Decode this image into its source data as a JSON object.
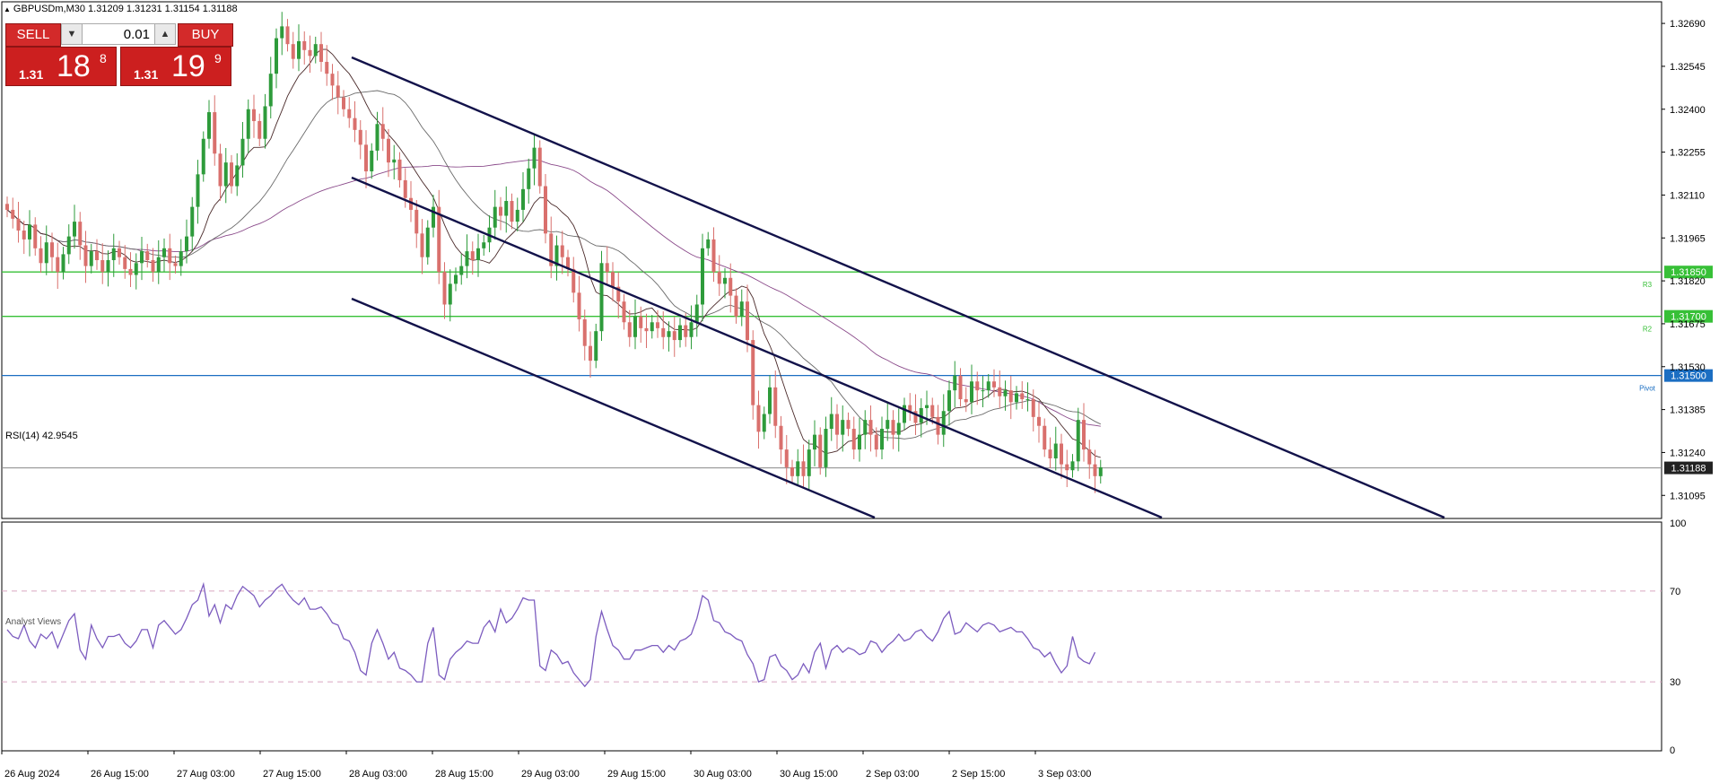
{
  "header": {
    "title": "GBPUSDm,M30  1.31209 1.31231 1.31154 1.31188"
  },
  "trade_panel": {
    "sell_label": "SELL",
    "buy_label": "BUY",
    "lot_value": "0.01",
    "sell_price": {
      "prefix": "1.31",
      "big": "18",
      "sup": "8"
    },
    "buy_price": {
      "prefix": "1.31",
      "big": "19",
      "sup": "9"
    }
  },
  "rsi_label": "RSI(14) 42.9545",
  "analyst_text": "Analyst Views",
  "colors": {
    "bull": "#2e9b3b",
    "bear": "#d9706d",
    "level_green": "#37c037",
    "pivot": "#1b6ec2",
    "channel": "#12124a",
    "ma_fast": "#4a2a2a",
    "ma_mid": "#6a6a6a",
    "ma_slow": "#8a4a8a",
    "rsi": "#7c5cbf",
    "rsi_level": "#d9a6c2",
    "current": "#888888"
  },
  "chart_data": {
    "type": "candlestick",
    "symbol": "GBPUSDm",
    "timeframe": "M30",
    "ylim": [
      1.3102,
      1.3276
    ],
    "y_ticks": [
      "1.32690",
      "1.32545",
      "1.32400",
      "1.32255",
      "1.32110",
      "1.31965",
      "1.31820",
      "1.31675",
      "1.31530",
      "1.31385",
      "1.31240",
      "1.31095"
    ],
    "x_ticks": [
      "26 Aug 2024",
      "26 Aug 15:00",
      "27 Aug 03:00",
      "27 Aug 15:00",
      "28 Aug 03:00",
      "28 Aug 15:00",
      "29 Aug 03:00",
      "29 Aug 15:00",
      "30 Aug 03:00",
      "30 Aug 15:00",
      "2 Sep 03:00",
      "2 Sep 15:00",
      "3 Sep 03:00"
    ],
    "current_price": "1.31188",
    "levels": [
      {
        "name": "R3",
        "label": "1.31850",
        "value": 1.3185,
        "kind": "resistance"
      },
      {
        "name": "R2",
        "label": "1.31700",
        "value": 1.317,
        "kind": "resistance"
      },
      {
        "name": "Pivot",
        "label": "1.31500",
        "value": 1.315,
        "kind": "pivot"
      }
    ],
    "closes": [
      1.3206,
      1.3203,
      1.3199,
      1.3196,
      1.3201,
      1.3193,
      1.3188,
      1.3195,
      1.319,
      1.3185,
      1.3191,
      1.3197,
      1.3202,
      1.3194,
      1.3187,
      1.3192,
      1.3189,
      1.3185,
      1.3189,
      1.3193,
      1.319,
      1.3186,
      1.3184,
      1.3188,
      1.3192,
      1.3189,
      1.3185,
      1.319,
      1.3193,
      1.3188,
      1.3187,
      1.3192,
      1.3197,
      1.3207,
      1.3218,
      1.323,
      1.3239,
      1.3225,
      1.3214,
      1.3222,
      1.3214,
      1.3221,
      1.323,
      1.324,
      1.3236,
      1.323,
      1.3241,
      1.3252,
      1.3264,
      1.3268,
      1.3262,
      1.3257,
      1.3263,
      1.326,
      1.3258,
      1.3262,
      1.3256,
      1.3252,
      1.3248,
      1.3244,
      1.324,
      1.3237,
      1.3233,
      1.3228,
      1.3219,
      1.3226,
      1.3235,
      1.323,
      1.3222,
      1.3223,
      1.3216,
      1.321,
      1.3206,
      1.3198,
      1.319,
      1.32,
      1.3207,
      1.3185,
      1.3174,
      1.3181,
      1.3184,
      1.3187,
      1.3192,
      1.3189,
      1.3193,
      1.3195,
      1.32,
      1.3207,
      1.3204,
      1.3209,
      1.3202,
      1.3206,
      1.3213,
      1.322,
      1.3227,
      1.3214,
      1.3198,
      1.3187,
      1.3194,
      1.319,
      1.3186,
      1.3178,
      1.3169,
      1.316,
      1.3155,
      1.3165,
      1.3188,
      1.3185,
      1.318,
      1.3175,
      1.3168,
      1.3163,
      1.317,
      1.3166,
      1.3165,
      1.3168,
      1.3166,
      1.3163,
      1.3165,
      1.3162,
      1.3167,
      1.3163,
      1.3168,
      1.3174,
      1.3193,
      1.3196,
      1.3185,
      1.3181,
      1.3183,
      1.3177,
      1.317,
      1.3175,
      1.3162,
      1.314,
      1.3131,
      1.3137,
      1.3146,
      1.3133,
      1.3125,
      1.3119,
      1.3116,
      1.3121,
      1.3116,
      1.3125,
      1.313,
      1.3119,
      1.3132,
      1.3137,
      1.313,
      1.3135,
      1.3132,
      1.3125,
      1.313,
      1.3135,
      1.313,
      1.3125,
      1.3132,
      1.3135,
      1.313,
      1.3134,
      1.314,
      1.3138,
      1.3134,
      1.3139,
      1.314,
      1.3136,
      1.313,
      1.3138,
      1.3145,
      1.315,
      1.3142,
      1.3141,
      1.3148,
      1.3145,
      1.3145,
      1.3148,
      1.3146,
      1.3143,
      1.3145,
      1.3141,
      1.3144,
      1.3142,
      1.3142,
      1.3136,
      1.3133,
      1.3125,
      1.3122,
      1.3127,
      1.312,
      1.3118,
      1.3121,
      1.3135,
      1.3125,
      1.312,
      1.3116,
      1.3119
    ],
    "rsi": {
      "label": "RSI(14) 42.9545",
      "ylim": [
        0,
        100
      ],
      "levels": [
        70,
        30
      ],
      "values": [
        53,
        50,
        49,
        55,
        48,
        45,
        51,
        49,
        52,
        45,
        51,
        57,
        60,
        44,
        40,
        55,
        49,
        45,
        50,
        50,
        51,
        47,
        45,
        48,
        53,
        53,
        45,
        55,
        57,
        54,
        51,
        53,
        58,
        64,
        66,
        73,
        59,
        64,
        56,
        64,
        62,
        68,
        72,
        70,
        68,
        63,
        66,
        68,
        71,
        73,
        69,
        66,
        64,
        67,
        62,
        62,
        63,
        60,
        56,
        55,
        49,
        48,
        43,
        35,
        33,
        47,
        53,
        47,
        40,
        43,
        36,
        35,
        33,
        30,
        30,
        47,
        54,
        33,
        31,
        40,
        43,
        45,
        48,
        47,
        47,
        54,
        57,
        52,
        62,
        56,
        58,
        62,
        67,
        66,
        66,
        37,
        35,
        44,
        42,
        38,
        39,
        34,
        31,
        28,
        31,
        50,
        61,
        53,
        46,
        44,
        40,
        40,
        44,
        44,
        45,
        46,
        46,
        43,
        46,
        44,
        48,
        49,
        51,
        58,
        68,
        66,
        57,
        56,
        52,
        51,
        49,
        48,
        42,
        38,
        30,
        31,
        41,
        42,
        37,
        35,
        31,
        33,
        38,
        34,
        43,
        47,
        36,
        44,
        46,
        43,
        45,
        44,
        42,
        43,
        48,
        47,
        43,
        46,
        48,
        51,
        48,
        49,
        52,
        53,
        50,
        48,
        52,
        58,
        61,
        51,
        52,
        56,
        54,
        52,
        55,
        56,
        55,
        52,
        53,
        54,
        52,
        52,
        49,
        45,
        44,
        41,
        43,
        38,
        34,
        37,
        50,
        41,
        39,
        38,
        43
      ]
    }
  }
}
